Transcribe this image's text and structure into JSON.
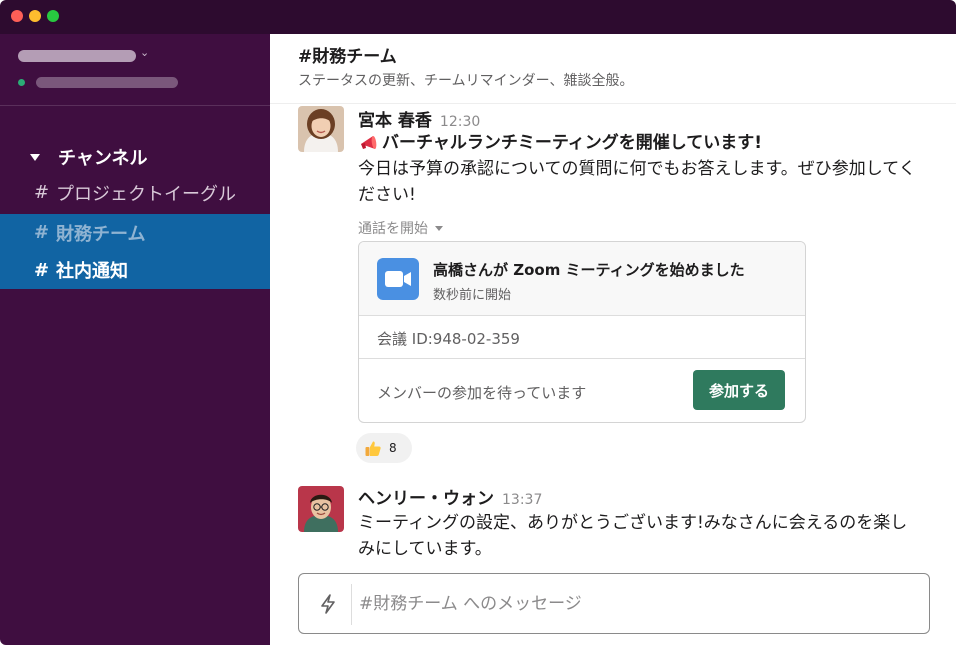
{
  "window": {
    "titlebar_color": "#2d0b2f"
  },
  "sidebar": {
    "background": "#3f0e40",
    "section_label": "チャンネル",
    "channels": [
      {
        "name": "プロジェクトイーグル",
        "hash": "#",
        "state": "normal"
      },
      {
        "name": "財務チーム",
        "hash": "#",
        "state": "active"
      },
      {
        "name": "社内通知",
        "hash": "#",
        "state": "highlighted"
      }
    ]
  },
  "channel": {
    "title": "#財務チーム",
    "topic": "ステータスの更新、チームリマインダー、雑談全般。"
  },
  "messages": [
    {
      "sender": "宮本 春香",
      "time": "12:30",
      "headline": "バーチャルランチミーティングを開催しています!",
      "body": "今日は予算の承認についての質問に何でもお答えします。ぜひ参加してください!",
      "call": {
        "label": "通話を開始",
        "title": "高橋さんが Zoom ミーティングを始めました",
        "subtitle": "数秒前に開始",
        "meeting_id": "会議 ID:948-02-359",
        "waiting_text": "メンバーの参加を待っています",
        "join_label": "参加する"
      },
      "reaction": {
        "icon": "thumbs-up-icon",
        "count": "8"
      }
    },
    {
      "sender": "ヘンリー・ウォン",
      "time": "13:37",
      "body": "ミーティングの設定、ありがとうございます!みなさんに会えるのを楽しみにしています。"
    }
  ],
  "composer": {
    "placeholder": "#財務チーム へのメッセージ"
  },
  "colors": {
    "accent_blue": "#1164a3",
    "join_green": "#2f7a5e",
    "zoom_blue": "#4a90e2"
  }
}
